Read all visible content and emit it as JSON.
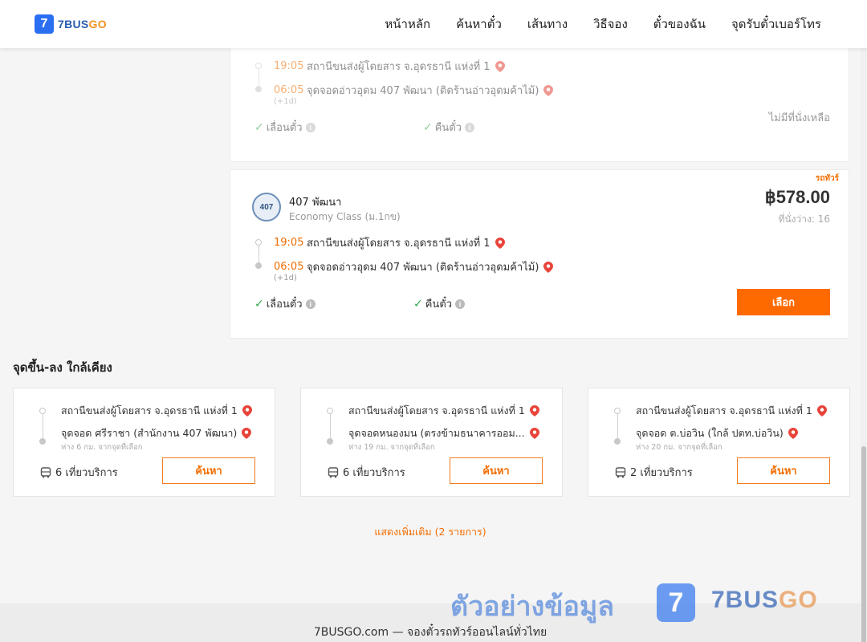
{
  "header": {
    "logo_mark": "7",
    "logo_text_a": "7BUS",
    "logo_text_b": "GO",
    "nav": [
      "หน้าหลัก",
      "ค้นหาตั๋ว",
      "เส้นทาง",
      "วิธีจอง",
      "ตั๋วของฉัน",
      "จุดรับตั๋วเบอร์โทร"
    ]
  },
  "trip1": {
    "depart_time": "19:05",
    "depart_stop": "สถานีขนส่งผู้โดยสาร จ.อุดรธานี แห่งที่ 1",
    "arrive_time": "06:05",
    "arrive_stop": "จุดจอดอ่าวอุดม 407 พัฒนา (ติดร้านอ่าวอุดมค้าไม้)",
    "next_day": "(+1d)",
    "feature_change": "เลื่อนตั๋ว",
    "feature_refund": "คืนตั๋ว",
    "status": "ไม่มีที่นั่งเหลือ"
  },
  "trip2": {
    "tag": "รถทัวร์",
    "operator_logo": "407",
    "operator": "407 พัฒนา",
    "class": "Economy Class (ม.1กข)",
    "price": "฿578.00",
    "seats": "ที่นั่งว่าง: 16",
    "depart_time": "19:05",
    "depart_stop": "สถานีขนส่งผู้โดยสาร จ.อุดรธานี แห่งที่ 1",
    "arrive_time": "06:05",
    "arrive_stop": "จุดจอดอ่าวอุดม 407 พัฒนา (ติดร้านอ่าวอุดมค้าไม้)",
    "next_day": "(+1d)",
    "feature_change": "เลื่อนตั๋ว",
    "feature_refund": "คืนตั๋ว",
    "select_label": "เลือก"
  },
  "nearby": {
    "title": "จุดขึ้น-ลง ใกล้เคียง",
    "items": [
      {
        "from": "สถานีขนส่งผู้โดยสาร จ.อุดรธานี แห่งที่ 1",
        "to": "จุดจอด ศรีราชา (สำนักงาน 407 พัฒนา)",
        "distance": "ห่าง 6 กม. จากจุดที่เลือก",
        "trips": "6 เที่ยวบริการ",
        "button": "ค้นหา"
      },
      {
        "from": "สถานีขนส่งผู้โดยสาร จ.อุดรธานี แห่งที่ 1",
        "to": "จุดจอดหนองมน (ตรงข้ามธนาคารออม...",
        "distance": "ห่าง 19 กม. จากจุดที่เลือก",
        "trips": "6 เที่ยวบริการ",
        "button": "ค้นหา"
      },
      {
        "from": "สถานีขนส่งผู้โดยสาร จ.อุดรธานี แห่งที่ 1",
        "to": "จุดจอด ต.บ่อวิน (ใกล้ ปตท.บ่อวิน)",
        "distance": "ห่าง 20 กม. จากจุดที่เลือก",
        "trips": "2 เที่ยวบริการ",
        "button": "ค้นหา"
      }
    ],
    "show_more": "แสดงเพิ่มเติม (2 รายการ)"
  },
  "footer": {
    "text": "7BUSGO.com — จองตั๋วรถทัวร์ออนไลน์ทั่วไทย"
  },
  "watermark": {
    "text": "ตัวอย่างข้อมูล",
    "logo_mark": "7",
    "brand_a": "7BUS",
    "brand_b": "GO"
  },
  "colors": {
    "accent": "#ff6a00",
    "brand_blue": "#2a6ef2",
    "check_green": "#2fa84f",
    "pin_red": "#e8443a"
  }
}
